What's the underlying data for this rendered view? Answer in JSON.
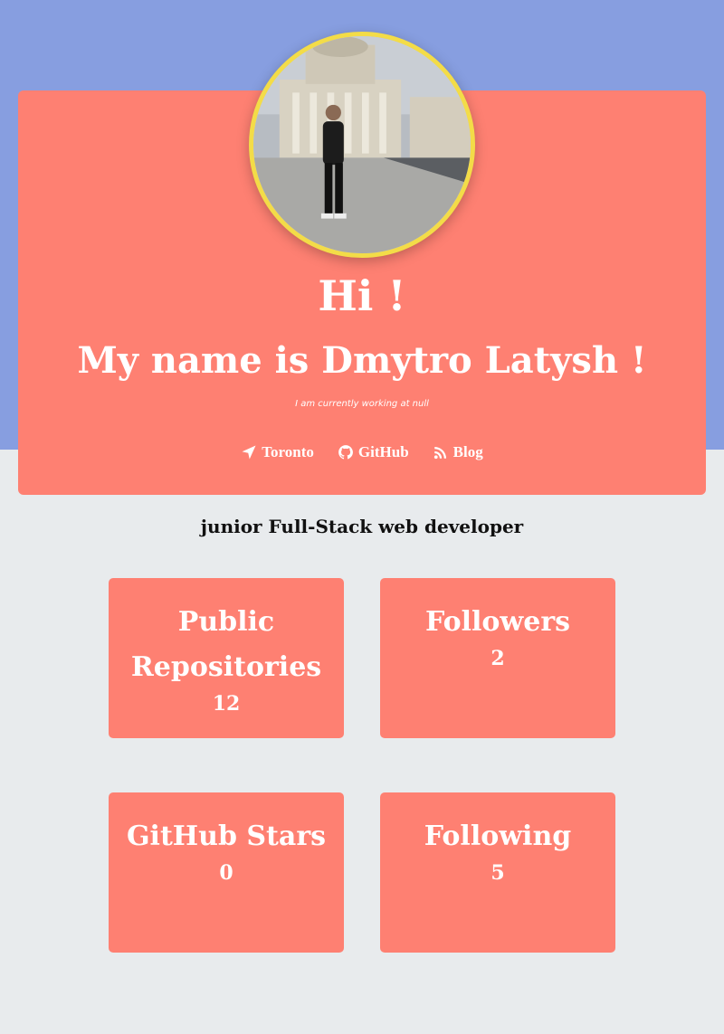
{
  "header": {
    "greeting": "Hi !",
    "name": "My name is Dmytro Latysh !",
    "subtitle": "I am currently working at null"
  },
  "links": [
    {
      "label": "Toronto",
      "icon": "location-arrow-icon"
    },
    {
      "label": "GitHub",
      "icon": "github-icon"
    },
    {
      "label": "Blog",
      "icon": "rss-icon"
    }
  ],
  "role": "junior Full-Stack web developer",
  "stats": [
    {
      "title": "Public Repositories",
      "value": "12"
    },
    {
      "title": "Followers",
      "value": "2"
    },
    {
      "title": "GitHub Stars",
      "value": "0"
    },
    {
      "title": "Following",
      "value": "5"
    }
  ],
  "colors": {
    "band": "#879ee0",
    "card": "#fe8072",
    "avatar_border": "#f3dc48",
    "background": "#e8ebed"
  }
}
